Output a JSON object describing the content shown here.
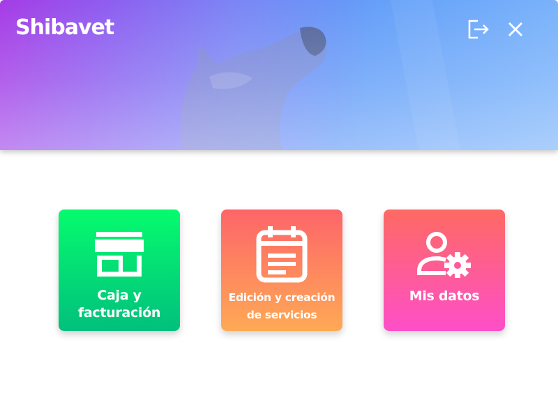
{
  "app": {
    "title": "Shibavet",
    "header_gradient": [
      "#a63be6",
      "#3f8cf7"
    ]
  },
  "header_actions": {
    "logout_icon": "logout-icon",
    "close_icon": "close-icon"
  },
  "tiles": [
    {
      "id": "caja",
      "icon": "storefront-icon",
      "label_lines": [
        "Caja y",
        "facturación"
      ],
      "colors": [
        "#06fb6e",
        "#01c07d"
      ]
    },
    {
      "id": "servicios",
      "icon": "calendar-icon",
      "label_lines": [
        "Edición y creación",
        "de servicios"
      ],
      "colors": [
        "#fd6569",
        "#fea955"
      ]
    },
    {
      "id": "datos",
      "icon": "user-settings-icon",
      "label_lines": [
        "Mis datos"
      ],
      "colors": [
        "#fe6a63",
        "#fe4fc8"
      ]
    }
  ]
}
